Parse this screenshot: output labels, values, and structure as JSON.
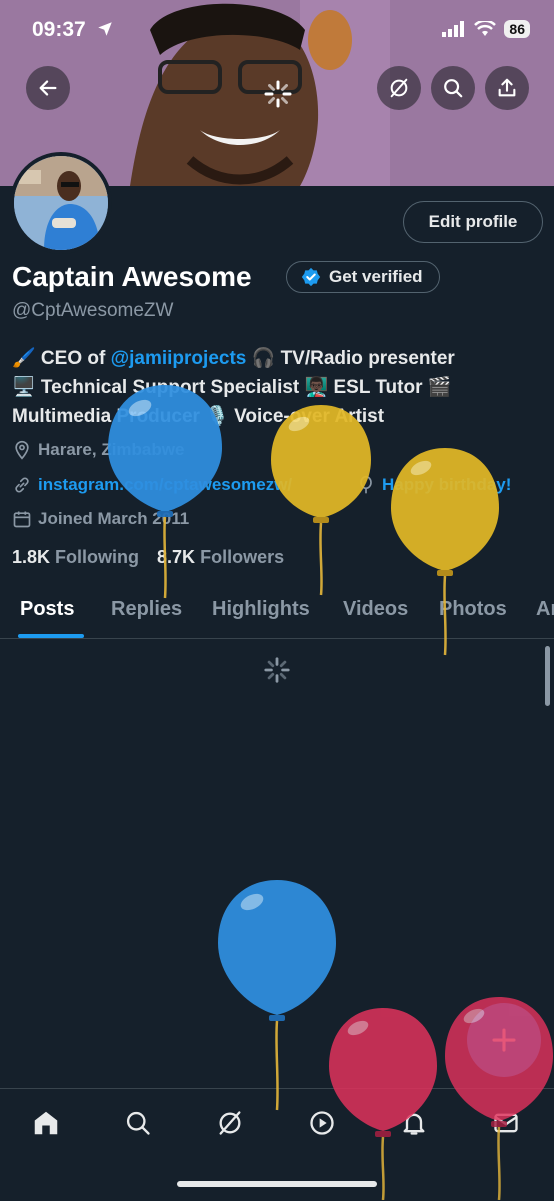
{
  "status": {
    "time": "09:37",
    "battery": "86"
  },
  "profile": {
    "name": "Captain Awesome",
    "verify_label": "Get verified",
    "handle": "@CptAwesomeZW",
    "edit_label": "Edit profile",
    "bio_line1_pre": "🖌️ CEO of ",
    "bio_mention": "@jamiiprojects",
    "bio_line1_post": " 🎧 TV/Radio presenter",
    "bio_line2": "🖥️ Technical Support Specialist 👨🏿‍🏫 ESL Tutor 🎬",
    "bio_line3": "Multimedia Producer 🎙️ Voice-over Artist",
    "location": "Harare, Zimbabwe",
    "website": "instagram.com/cptawesomezw/",
    "birthday": "Happy birthday!",
    "joined": "Joined March 2011",
    "following_count": "1.8K",
    "following_label": "Following",
    "followers_count": "8.7K",
    "followers_label": "Followers"
  },
  "tabs": [
    "Posts",
    "Replies",
    "Highlights",
    "Videos",
    "Photos",
    "Ar"
  ],
  "icons": {
    "back": "arrow-left-icon",
    "grok": "grok-icon",
    "search": "search-icon",
    "share": "share-icon",
    "compose": "plus-icon",
    "nav": [
      "home-icon",
      "search-icon",
      "grok-icon",
      "play-icon",
      "bell-icon",
      "mail-icon"
    ]
  },
  "colors": {
    "accent": "#1d9bf0",
    "background": "#15202b",
    "muted": "#8b98a5"
  }
}
